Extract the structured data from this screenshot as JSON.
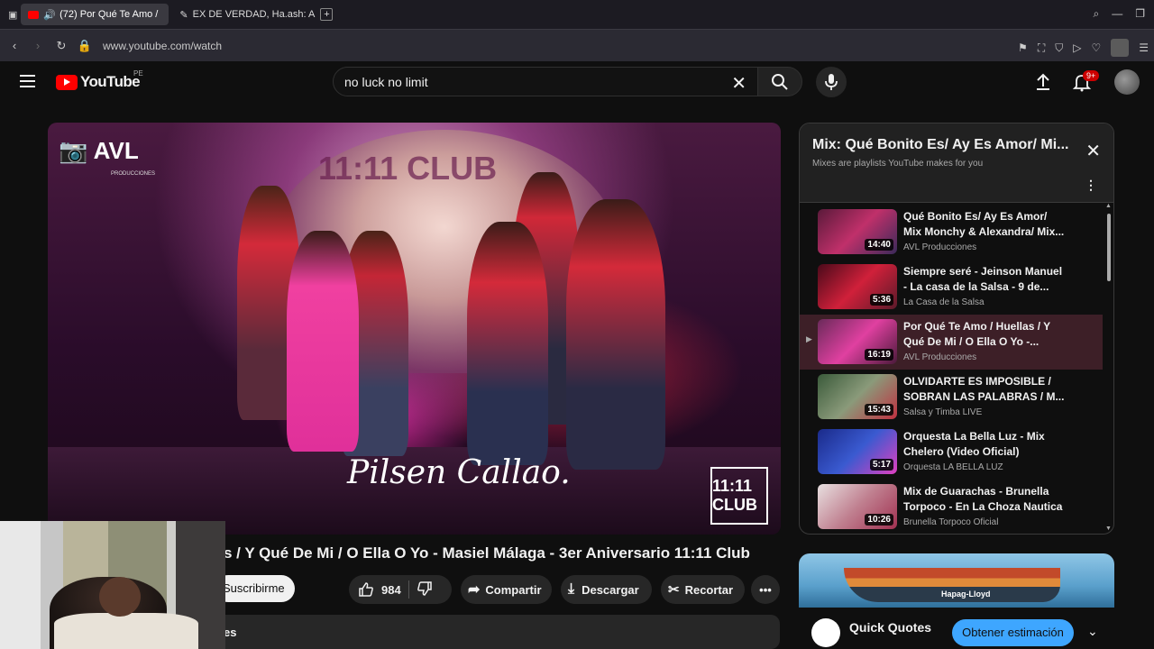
{
  "browser": {
    "tabs": [
      {
        "label": "(72) Por Qué Te Amo /"
      },
      {
        "label": "EX DE VERDAD, Ha.ash: A"
      }
    ],
    "new_tab": "+",
    "url": "www.youtube.com/watch"
  },
  "header": {
    "logo_text": "YouTube",
    "country_code": "PE",
    "search_value": "no luck no limit",
    "notif_count": "9+"
  },
  "player": {
    "watermark_brand": "AVL",
    "watermark_sub": "PRODUCCIONES",
    "overlay_script": "Pilsen Callao.",
    "club_badge": "11:11 CLUB"
  },
  "video": {
    "title_visible": "s / Y Qué De Mi / O Ella O Yo - Masiel Málaga - 3er Aniversario 11:11 Club",
    "subscribe_label": "Suscribirme",
    "likes": "984",
    "share_label": "Compartir",
    "download_label": "Descargar",
    "clip_label": "Recortar",
    "desc_fragment": "es"
  },
  "playlist": {
    "title": "Mix: Qué Bonito Es/ Ay Es Amor/ Mi...",
    "subtitle": "Mixes are playlists YouTube makes for you",
    "items": [
      {
        "title": "Qué Bonito Es/ Ay Es Amor/ Mix Monchy & Alexandra/ Mix...",
        "channel": "AVL Producciones",
        "duration": "14:40",
        "active": false
      },
      {
        "title": "Siempre seré - Jeinson Manuel - La casa de la Salsa - 9 de...",
        "channel": "La Casa de la Salsa",
        "duration": "5:36",
        "active": false
      },
      {
        "title": "Por Qué Te Amo / Huellas / Y Qué De Mi / O Ella O Yo -...",
        "channel": "AVL Producciones",
        "duration": "16:19",
        "active": true
      },
      {
        "title": "OLVIDARTE ES IMPOSIBLE / SOBRAN LAS PALABRAS / M...",
        "channel": "Salsa y Timba LIVE",
        "duration": "15:43",
        "active": false
      },
      {
        "title": "Orquesta La Bella Luz - Mix Chelero (Video Oficial)",
        "channel": "Orquesta LA BELLA LUZ",
        "duration": "5:17",
        "active": false
      },
      {
        "title": "Mix de Guarachas - Brunella Torpoco - En La Choza Nautica",
        "channel": "Brunella Torpoco Oficial",
        "duration": "10:26",
        "active": false
      }
    ]
  },
  "ad": {
    "ship_name": "Hapag-Lloyd",
    "title": "Quick Quotes",
    "cta": "Obtener estimación"
  }
}
